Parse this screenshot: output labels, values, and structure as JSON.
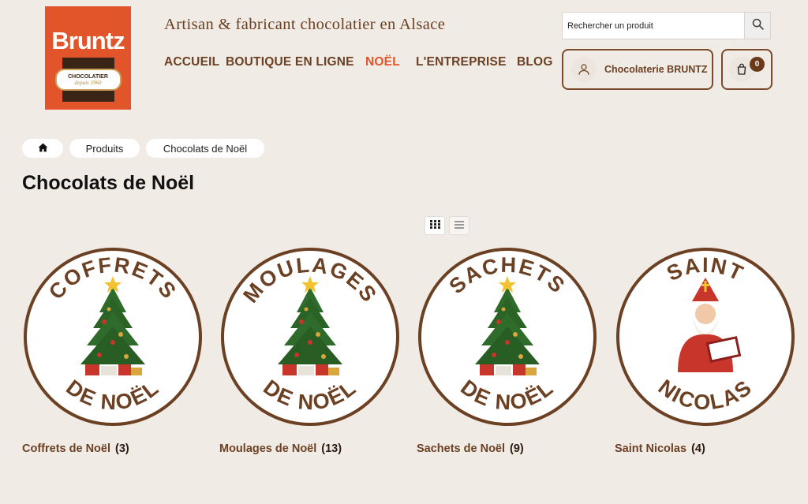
{
  "logo": {
    "brand": "Bruntz",
    "line1": "CHOCOLATIER",
    "line2": "depuis 1960"
  },
  "header": {
    "tagline": "Artisan & fabricant chocolatier en Alsace"
  },
  "nav": [
    {
      "label": "ACCUEIL"
    },
    {
      "label": "BOUTIQUE EN LIGNE"
    },
    {
      "label": "NOËL"
    },
    {
      "label": "L'ENTREPRISE"
    },
    {
      "label": "BLOG"
    }
  ],
  "search": {
    "placeholder": "Rechercher un produit"
  },
  "account": {
    "name": "Chocolaterie BRUNTZ"
  },
  "cart": {
    "count": "0"
  },
  "breadcrumb": {
    "home_icon": "home-icon",
    "items": [
      "Produits",
      "Chocolats de Noël"
    ]
  },
  "page": {
    "title": "Chocolats de Noël"
  },
  "view": {
    "grid_icon": "grid-icon",
    "list_icon": "list-icon"
  },
  "categories": [
    {
      "name": "Coffrets de Noël",
      "count": "(3)",
      "top": "COFFRETS",
      "bottom": "DE NOËL",
      "image": "christmas-tree"
    },
    {
      "name": "Moulages de Noël",
      "count": "(13)",
      "top": "MOULAGES",
      "bottom": "DE NOËL",
      "image": "christmas-tree"
    },
    {
      "name": "Sachets de Noël",
      "count": "(9)",
      "top": "SACHETS",
      "bottom": "DE NOËL",
      "image": "christmas-tree"
    },
    {
      "name": "Saint Nicolas",
      "count": "(4)",
      "top": "SAINT",
      "bottom": "NICOLAS",
      "image": "saint-nicolas"
    }
  ],
  "colors": {
    "accent": "#e2552a",
    "brown": "#6b4023",
    "background": "#f1ebe5"
  }
}
